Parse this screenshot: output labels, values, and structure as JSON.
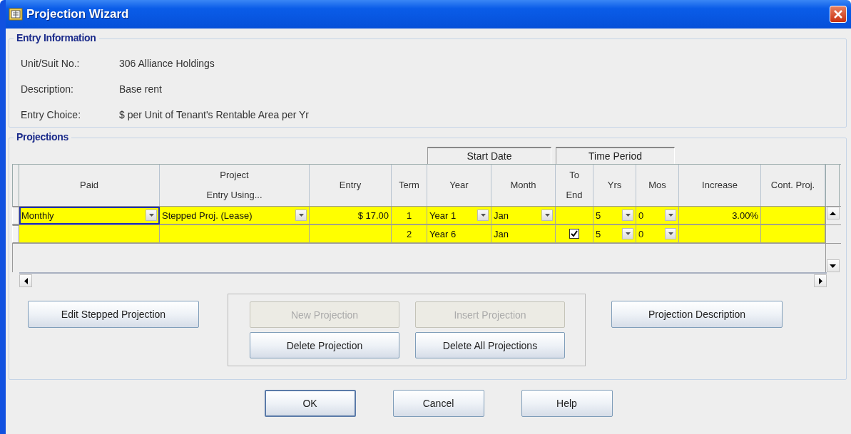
{
  "window": {
    "title": "Projection Wizard"
  },
  "entry_information": {
    "title": "Entry Information",
    "fields": [
      {
        "label": "Unit/Suit No.:",
        "value": "306 Alliance Holdings"
      },
      {
        "label": "Description:",
        "value": "Base rent"
      },
      {
        "label": "Entry Choice:",
        "value": "$ per Unit of Tenant's Rentable Area per Yr"
      }
    ]
  },
  "projections": {
    "title": "Projections",
    "header_groups": [
      {
        "label": "Start Date"
      },
      {
        "label": "Time Period"
      }
    ],
    "columns": [
      "Paid",
      "Project\nEntry Using...",
      "Entry",
      "Term",
      "Year",
      "Month",
      "To\nEnd",
      "Yrs",
      "Mos",
      "Increase",
      "Cont. Proj."
    ],
    "rows": [
      {
        "cells": [
          {
            "kind": "combo",
            "value": "Monthly",
            "focused": true
          },
          {
            "kind": "combo",
            "value": "Stepped Proj. (Lease)",
            "focused": false
          },
          {
            "kind": "number",
            "value": "$ 17.00",
            "focused": false
          },
          {
            "kind": "center",
            "value": "1",
            "focused": false
          },
          {
            "kind": "combo",
            "value": "Year 1",
            "focused": false
          },
          {
            "kind": "combo",
            "value": "Jan",
            "focused": false
          },
          {
            "kind": "blank",
            "focused": false
          },
          {
            "kind": "combo",
            "value": "5",
            "focused": false
          },
          {
            "kind": "combo",
            "value": "0",
            "focused": false
          },
          {
            "kind": "number",
            "value": "3.00%",
            "focused": false
          },
          {
            "kind": "blank",
            "focused": false
          }
        ]
      },
      {
        "cells": [
          {
            "kind": "blank",
            "focused": false
          },
          {
            "kind": "blank",
            "focused": false
          },
          {
            "kind": "blank",
            "focused": false
          },
          {
            "kind": "center",
            "value": "2",
            "focused": false
          },
          {
            "kind": "text",
            "value": "Year 6",
            "focused": false
          },
          {
            "kind": "text",
            "value": "Jan",
            "focused": false
          },
          {
            "kind": "check",
            "checked": true,
            "focused": false
          },
          {
            "kind": "combo",
            "value": "5",
            "focused": false
          },
          {
            "kind": "combo",
            "value": "0",
            "focused": false
          },
          {
            "kind": "blank",
            "focused": false
          },
          {
            "kind": "blank",
            "focused": false
          }
        ]
      }
    ],
    "left_buttons": [
      {
        "label": "Edit Stepped Projection",
        "disabled": false
      }
    ],
    "group_buttons": [
      {
        "label": "New Projection",
        "disabled": true
      },
      {
        "label": "Insert Projection",
        "disabled": true
      },
      {
        "label": "Delete Projection",
        "disabled": false
      },
      {
        "label": "Delete All Projections",
        "disabled": false
      }
    ],
    "right_buttons": [
      {
        "label": "Projection Description",
        "disabled": false
      }
    ]
  },
  "dialog_buttons": [
    {
      "label": "OK",
      "default": true
    },
    {
      "label": "Cancel",
      "default": false
    },
    {
      "label": "Help",
      "default": false
    }
  ]
}
